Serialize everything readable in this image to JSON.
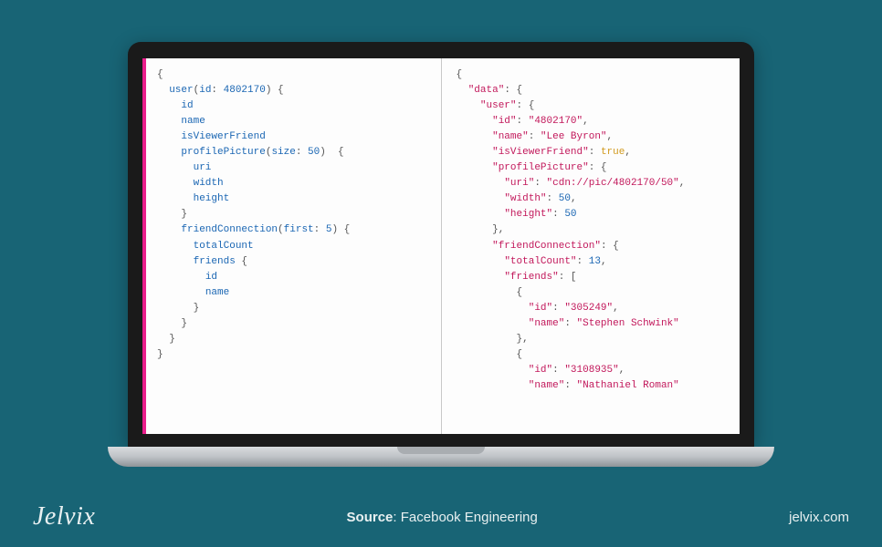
{
  "query": {
    "userId": "4802170",
    "pictureSize": "50",
    "friendsFirst": "5",
    "fields": {
      "f1": "id",
      "f2": "name",
      "f3": "isViewerFriend",
      "pp_uri": "uri",
      "pp_width": "width",
      "pp_height": "height",
      "fc_total": "totalCount",
      "fc_friends": "friends",
      "fr_id": "id",
      "fr_name": "name"
    },
    "labels": {
      "user": "user",
      "id": "id",
      "profilePicture": "profilePicture",
      "size": "size",
      "friendConnection": "friendConnection",
      "first": "first"
    }
  },
  "response": {
    "dataKey": "\"data\"",
    "userKey": "\"user\"",
    "idKey": "\"id\"",
    "idVal": "\"4802170\"",
    "nameKey": "\"name\"",
    "nameVal": "\"Lee Byron\"",
    "ivfKey": "\"isViewerFriend\"",
    "ivfVal": "true",
    "ppKey": "\"profilePicture\"",
    "uriKey": "\"uri\"",
    "uriVal": "\"cdn://pic/4802170/50\"",
    "widthKey": "\"width\"",
    "widthVal": "50",
    "heightKey": "\"height\"",
    "heightVal": "50",
    "fcKey": "\"friendConnection\"",
    "tcKey": "\"totalCount\"",
    "tcVal": "13",
    "friendsKey": "\"friends\"",
    "f1idKey": "\"id\"",
    "f1idVal": "\"305249\"",
    "f1nameKey": "\"name\"",
    "f1nameVal": "\"Stephen Schwink\"",
    "f2idKey": "\"id\"",
    "f2idVal": "\"3108935\"",
    "f2nameKey": "\"name\"",
    "f2nameVal": "\"Nathaniel Roman\""
  },
  "footer": {
    "logo": "Jelvix",
    "sourceLabel": "Source",
    "sourceValue": "Facebook Engineering",
    "url": "jelvix.com"
  }
}
